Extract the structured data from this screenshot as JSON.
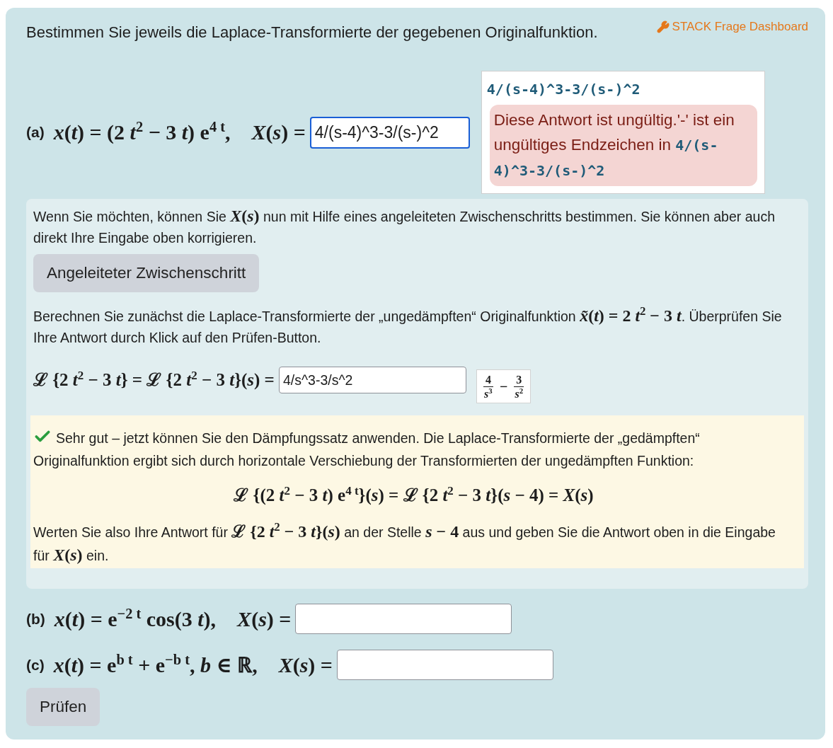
{
  "header": {
    "instruction": "Bestimmen Sie jeweils die Laplace-Transformierte der gegebenen Originalfunktion.",
    "dashboard_link": "STACK Frage Dashboard"
  },
  "parts": [
    {
      "label": "(a)",
      "function": "*x*(*t*) = (2 *t*$^{2}$ − 3 *t*) e$^{4 t}$,",
      "result_label": "*X*(*s*) =",
      "input": {
        "value": "4/(s-4)^3-3/(s-)^2",
        "focused": true
      },
      "validation": {
        "echo": "4/(s-4)^3-3/(s-)^2",
        "error": {
          "text": "Diese Antwort ist ungültig.'-' ist ein ungültiges Endzeichen in ",
          "code": "4/(s-4)^3-3/(s-)^2"
        }
      },
      "guidance": {
        "intro": [
          {
            "kind": "text",
            "text": "Wenn Sie möchten, können Sie "
          },
          {
            "kind": "math",
            "text": "*X*(*s*)"
          },
          {
            "kind": "text",
            "text": " nun mit Hilfe eines angeleiteten Zwischenschritts bestimmen. Sie können aber auch direkt Ihre Eingabe oben korrigieren."
          }
        ],
        "button": "Angeleiteter Zwischenschritt",
        "task": [
          {
            "kind": "text",
            "text": "Berechnen Sie zunächst die Laplace-Transformierte der „ungedämpften“ Originalfunktion "
          },
          {
            "kind": "math",
            "text": "*x̃*(*t*) = 2 *t*$^{2}$ − 3 *t*"
          },
          {
            "kind": "text",
            "text": ". Überprüfen Sie Ihre Antwort durch Klick auf den Prüfen-Button."
          }
        ],
        "equation": {
          "lhs": "ℒ {2 *t*$^{2}$ − 3 *t*} = ℒ {2 *t*$^{2}$ − 3 *t*}(*s*) =",
          "input": {
            "value": "4/s^3-3/s^2",
            "focused": false
          },
          "preview": {
            "fractions": [
              {
                "numerator": "4",
                "denominator": "*s*$^{3}$"
              },
              {
                "numerator": "3",
                "denominator": "*s*$^{2}$"
              }
            ],
            "operator": "−"
          }
        },
        "feedback": {
          "correct": true,
          "lead": [
            {
              "kind": "text",
              "text": "Sehr gut – jetzt können Sie den Dämpfungssatz anwenden. Die Laplace-Transformierte der „gedämpften“ Originalfunktion ergibt sich durch horizontale Verschiebung der Transformierten der ungedämpften Funktion:"
            }
          ],
          "display_equation": "ℒ {(2 *t*$^{2}$ − 3 *t*) e$^{4 t}$}(*s*) = ℒ {2 *t*$^{2}$ − 3 *t*}(*s* − 4) = *X*(*s*)",
          "closing": [
            {
              "kind": "text",
              "text": "Werten Sie also Ihre Antwort für "
            },
            {
              "kind": "math",
              "text": "ℒ {2 *t*$^{2}$ − 3 *t*}(*s*)"
            },
            {
              "kind": "text",
              "text": " an der Stelle "
            },
            {
              "kind": "math",
              "text": "*s* − 4"
            },
            {
              "kind": "text",
              "text": " aus und geben Sie die Antwort oben in die Eingabe für "
            },
            {
              "kind": "math",
              "text": "*X*(*s*)"
            },
            {
              "kind": "text",
              "text": " ein."
            }
          ]
        }
      }
    },
    {
      "label": "(b)",
      "function": "*x*(*t*) = e$^{−2 t}$ cos(3 *t*),",
      "result_label": "*X*(*s*) =",
      "input": {
        "focused": false
      }
    },
    {
      "label": "(c)",
      "function": "*x*(*t*) = e$^{b t}$ + e$^{−b t}$, *b* ∈ ℝ,",
      "result_label": "*X*(*s*) =",
      "input": {
        "focused": false
      }
    }
  ],
  "submit_button": "Prüfen"
}
